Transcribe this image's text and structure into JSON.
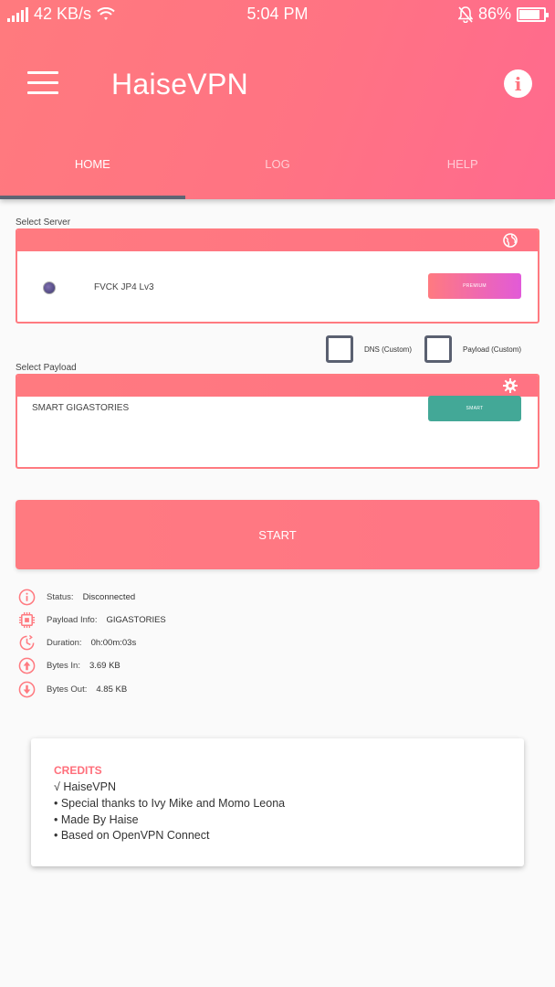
{
  "statusbar": {
    "network_speed": "42 KB/s",
    "time": "5:04 PM",
    "battery": "86%"
  },
  "header": {
    "title": "HaiseVPN"
  },
  "tabs": [
    {
      "label": "HOME",
      "active": true
    },
    {
      "label": "LOG",
      "active": false
    },
    {
      "label": "HELP",
      "active": false
    }
  ],
  "server_section": {
    "label": "Select Server",
    "server_name": "FVCK JP4 Lv3",
    "badge": "PREMIUM"
  },
  "options": {
    "dns_label": "DNS (Custom)",
    "payload_label": "Payload (Custom)"
  },
  "payload_section": {
    "label": "Select Payload",
    "payload_name": "SMART GIGASTORIES",
    "badge": "SMART"
  },
  "start_button": {
    "label": "START"
  },
  "status": [
    {
      "icon": "info-icon",
      "label": "Status:",
      "value": "Disconnected"
    },
    {
      "icon": "chip-icon",
      "label": "Payload Info:",
      "value": "GIGASTORIES"
    },
    {
      "icon": "clock-icon",
      "label": "Duration:",
      "value": "0h:00m:03s"
    },
    {
      "icon": "arrow-up-icon",
      "label": "Bytes In:",
      "value": "3.69 KB"
    },
    {
      "icon": "arrow-down-icon",
      "label": "Bytes Out:",
      "value": "4.85 KB"
    }
  ],
  "credits": {
    "title": "CREDITS",
    "lines": [
      "√ HaiseVPN",
      "• Special thanks to Ivy Mike and Momo Leona",
      "• Made By Haise",
      "• Based on OpenVPN Connect"
    ]
  },
  "colors": {
    "accent": "#ff7a80",
    "accent_secondary": "#e25ad8",
    "smart_badge": "#43a897",
    "tab_indicator": "#5e6473"
  }
}
